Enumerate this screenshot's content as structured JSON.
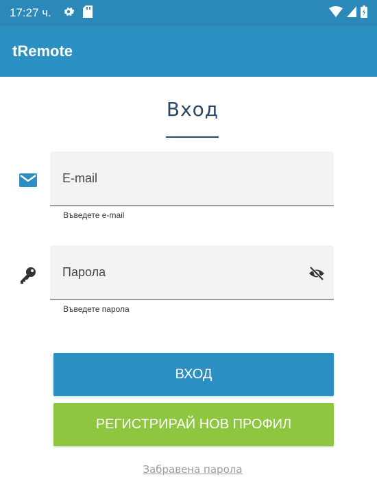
{
  "status_bar": {
    "time": "17:27 ч."
  },
  "app_bar": {
    "title": "tRemote"
  },
  "login": {
    "title": "Вход",
    "email": {
      "label": "E-mail",
      "helper": "Въведете e-mail"
    },
    "password": {
      "label": "Парола",
      "helper": "Въведете парола"
    },
    "login_button": "ВХОД",
    "register_button": "РЕГИСТРИРАЙ НОВ ПРОФИЛ",
    "forgot_password": "Забравена парола"
  },
  "colors": {
    "app_bar": "#2b90c2",
    "status_bar": "#2a89b8",
    "login_button": "#2b8fc1",
    "register_button": "#8ec640",
    "title": "#2a4766"
  },
  "icons": {
    "status": [
      "settings-icon",
      "sd-card-icon",
      "wifi-icon",
      "signal-icon",
      "battery-icon"
    ],
    "email": "mail-icon",
    "password": "key-icon",
    "toggle": "eye-off-icon"
  }
}
